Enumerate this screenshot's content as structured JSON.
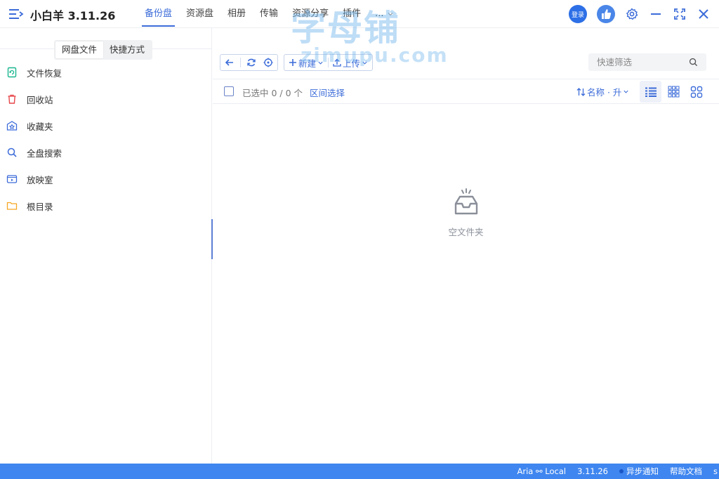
{
  "app": {
    "title": "小白羊 3.11.26"
  },
  "nav": {
    "tabs": [
      "备份盘",
      "资源盘",
      "相册",
      "传输",
      "资源分享",
      "插件",
      "..."
    ]
  },
  "top_actions": {
    "login_label": "登录"
  },
  "watermark": {
    "cn": "字母铺",
    "en": "zimupu.com"
  },
  "sidebar": {
    "segments": [
      "网盘文件",
      "快捷方式"
    ],
    "items": [
      {
        "label": "文件恢复",
        "icon": "file-restore-icon",
        "color": "#19b68f"
      },
      {
        "label": "回收站",
        "icon": "trash-icon",
        "color": "#e8474b"
      },
      {
        "label": "收藏夹",
        "icon": "favorites-icon",
        "color": "#3c6cd9"
      },
      {
        "label": "全盘搜索",
        "icon": "search-icon",
        "color": "#3c6cd9"
      },
      {
        "label": "放映室",
        "icon": "video-room-icon",
        "color": "#3c6cd9"
      },
      {
        "label": "根目录",
        "icon": "folder-icon",
        "color": "#f5a623"
      }
    ]
  },
  "toolbar": {
    "new_label": "新建",
    "upload_label": "上传",
    "filter_placeholder": "快速筛选"
  },
  "selection": {
    "selected_text": "已选中 0 / 0 个",
    "range_label": "区间选择",
    "sort_label": "名称 · 升"
  },
  "empty": {
    "text": "空文件夹"
  },
  "status": {
    "aria": "Aria ⚯ Local",
    "version": "3.11.26",
    "async_notice": "异步通知",
    "help": "帮助文档",
    "more": "s"
  },
  "colors": {
    "accent": "#3c6cd9",
    "statusbar": "#3f86f0"
  }
}
